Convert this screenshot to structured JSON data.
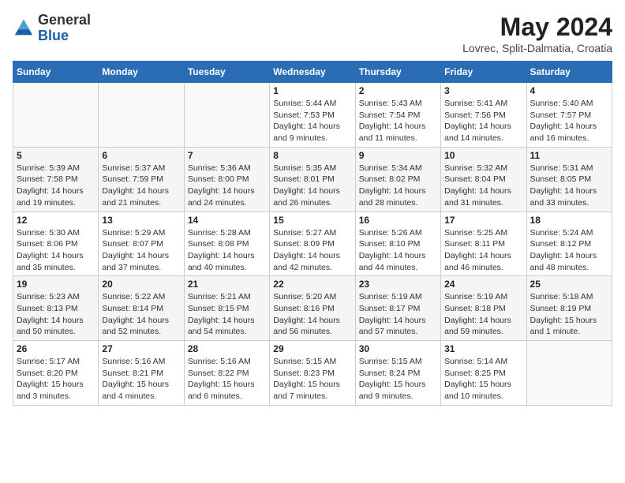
{
  "header": {
    "logo_general": "General",
    "logo_blue": "Blue",
    "month_year": "May 2024",
    "location": "Lovrec, Split-Dalmatia, Croatia"
  },
  "days_of_week": [
    "Sunday",
    "Monday",
    "Tuesday",
    "Wednesday",
    "Thursday",
    "Friday",
    "Saturday"
  ],
  "weeks": [
    [
      {
        "day": "",
        "info": ""
      },
      {
        "day": "",
        "info": ""
      },
      {
        "day": "",
        "info": ""
      },
      {
        "day": "1",
        "info": "Sunrise: 5:44 AM\nSunset: 7:53 PM\nDaylight: 14 hours\nand 9 minutes."
      },
      {
        "day": "2",
        "info": "Sunrise: 5:43 AM\nSunset: 7:54 PM\nDaylight: 14 hours\nand 11 minutes."
      },
      {
        "day": "3",
        "info": "Sunrise: 5:41 AM\nSunset: 7:56 PM\nDaylight: 14 hours\nand 14 minutes."
      },
      {
        "day": "4",
        "info": "Sunrise: 5:40 AM\nSunset: 7:57 PM\nDaylight: 14 hours\nand 16 minutes."
      }
    ],
    [
      {
        "day": "5",
        "info": "Sunrise: 5:39 AM\nSunset: 7:58 PM\nDaylight: 14 hours\nand 19 minutes."
      },
      {
        "day": "6",
        "info": "Sunrise: 5:37 AM\nSunset: 7:59 PM\nDaylight: 14 hours\nand 21 minutes."
      },
      {
        "day": "7",
        "info": "Sunrise: 5:36 AM\nSunset: 8:00 PM\nDaylight: 14 hours\nand 24 minutes."
      },
      {
        "day": "8",
        "info": "Sunrise: 5:35 AM\nSunset: 8:01 PM\nDaylight: 14 hours\nand 26 minutes."
      },
      {
        "day": "9",
        "info": "Sunrise: 5:34 AM\nSunset: 8:02 PM\nDaylight: 14 hours\nand 28 minutes."
      },
      {
        "day": "10",
        "info": "Sunrise: 5:32 AM\nSunset: 8:04 PM\nDaylight: 14 hours\nand 31 minutes."
      },
      {
        "day": "11",
        "info": "Sunrise: 5:31 AM\nSunset: 8:05 PM\nDaylight: 14 hours\nand 33 minutes."
      }
    ],
    [
      {
        "day": "12",
        "info": "Sunrise: 5:30 AM\nSunset: 8:06 PM\nDaylight: 14 hours\nand 35 minutes."
      },
      {
        "day": "13",
        "info": "Sunrise: 5:29 AM\nSunset: 8:07 PM\nDaylight: 14 hours\nand 37 minutes."
      },
      {
        "day": "14",
        "info": "Sunrise: 5:28 AM\nSunset: 8:08 PM\nDaylight: 14 hours\nand 40 minutes."
      },
      {
        "day": "15",
        "info": "Sunrise: 5:27 AM\nSunset: 8:09 PM\nDaylight: 14 hours\nand 42 minutes."
      },
      {
        "day": "16",
        "info": "Sunrise: 5:26 AM\nSunset: 8:10 PM\nDaylight: 14 hours\nand 44 minutes."
      },
      {
        "day": "17",
        "info": "Sunrise: 5:25 AM\nSunset: 8:11 PM\nDaylight: 14 hours\nand 46 minutes."
      },
      {
        "day": "18",
        "info": "Sunrise: 5:24 AM\nSunset: 8:12 PM\nDaylight: 14 hours\nand 48 minutes."
      }
    ],
    [
      {
        "day": "19",
        "info": "Sunrise: 5:23 AM\nSunset: 8:13 PM\nDaylight: 14 hours\nand 50 minutes."
      },
      {
        "day": "20",
        "info": "Sunrise: 5:22 AM\nSunset: 8:14 PM\nDaylight: 14 hours\nand 52 minutes."
      },
      {
        "day": "21",
        "info": "Sunrise: 5:21 AM\nSunset: 8:15 PM\nDaylight: 14 hours\nand 54 minutes."
      },
      {
        "day": "22",
        "info": "Sunrise: 5:20 AM\nSunset: 8:16 PM\nDaylight: 14 hours\nand 56 minutes."
      },
      {
        "day": "23",
        "info": "Sunrise: 5:19 AM\nSunset: 8:17 PM\nDaylight: 14 hours\nand 57 minutes."
      },
      {
        "day": "24",
        "info": "Sunrise: 5:19 AM\nSunset: 8:18 PM\nDaylight: 14 hours\nand 59 minutes."
      },
      {
        "day": "25",
        "info": "Sunrise: 5:18 AM\nSunset: 8:19 PM\nDaylight: 15 hours\nand 1 minute."
      }
    ],
    [
      {
        "day": "26",
        "info": "Sunrise: 5:17 AM\nSunset: 8:20 PM\nDaylight: 15 hours\nand 3 minutes."
      },
      {
        "day": "27",
        "info": "Sunrise: 5:16 AM\nSunset: 8:21 PM\nDaylight: 15 hours\nand 4 minutes."
      },
      {
        "day": "28",
        "info": "Sunrise: 5:16 AM\nSunset: 8:22 PM\nDaylight: 15 hours\nand 6 minutes."
      },
      {
        "day": "29",
        "info": "Sunrise: 5:15 AM\nSunset: 8:23 PM\nDaylight: 15 hours\nand 7 minutes."
      },
      {
        "day": "30",
        "info": "Sunrise: 5:15 AM\nSunset: 8:24 PM\nDaylight: 15 hours\nand 9 minutes."
      },
      {
        "day": "31",
        "info": "Sunrise: 5:14 AM\nSunset: 8:25 PM\nDaylight: 15 hours\nand 10 minutes."
      },
      {
        "day": "",
        "info": ""
      }
    ]
  ]
}
